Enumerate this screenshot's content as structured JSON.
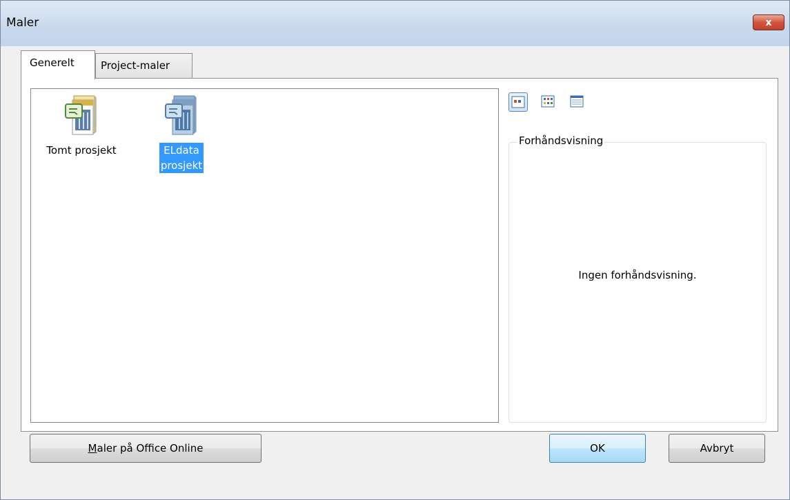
{
  "window": {
    "title": "Maler",
    "close_label": "x"
  },
  "tabs": [
    {
      "label": "Generelt",
      "active": true
    },
    {
      "label": "Project-maler",
      "active": false
    }
  ],
  "templates": [
    {
      "label": "Tomt prosjekt",
      "icon": "project-template-icon",
      "selected": false
    },
    {
      "label_lines": [
        "ELdata",
        "prosjekt"
      ],
      "icon": "project-template-icon",
      "selected": true
    }
  ],
  "view_buttons": [
    {
      "icon": "large-icons-view-icon",
      "active": true
    },
    {
      "icon": "list-view-icon",
      "active": false
    },
    {
      "icon": "details-view-icon",
      "active": false
    }
  ],
  "preview": {
    "legend": "Forhåndsvisning",
    "empty_text": "Ingen forhåndsvisning."
  },
  "buttons": {
    "online": "Maler på Office Online",
    "online_mnemonic": "M",
    "online_rest": "aler på Office Online",
    "ok": "OK",
    "cancel": "Avbryt"
  },
  "colors": {
    "selection": "#3399ff",
    "titlebar": "#c9d9ec",
    "close": "#c4412a"
  }
}
